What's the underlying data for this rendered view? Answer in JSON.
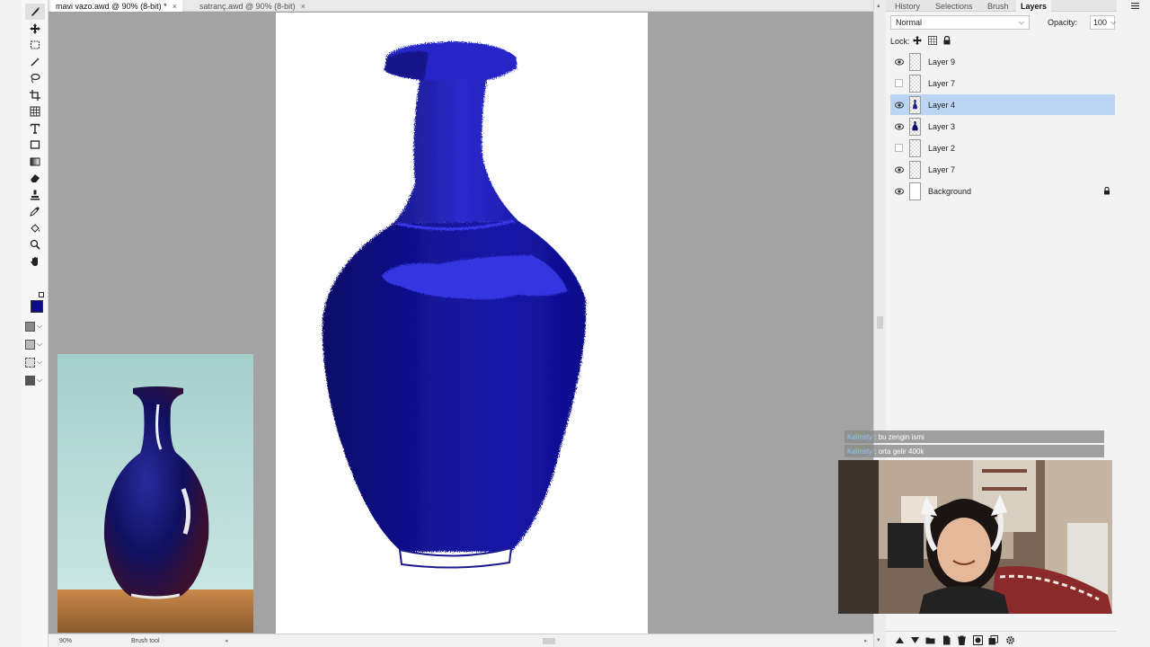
{
  "tabs": [
    {
      "label": "mavi vazo.awd @ 90% (8-bit) *",
      "close": "×",
      "active": true
    },
    {
      "label": "satranç.awd @ 90% (8-bit)",
      "close": "×",
      "active": false
    }
  ],
  "toolbar": {
    "tools": [
      "brush-icon",
      "move-icon",
      "rect-select-icon",
      "magic-wand-icon",
      "lasso-icon",
      "crop-icon",
      "grid-icon",
      "text-icon",
      "shape-icon",
      "gradient-icon",
      "eraser-icon",
      "stamp-icon",
      "eyedropper-icon",
      "fill-icon",
      "zoom-icon",
      "hand-icon"
    ],
    "active_tool": "brush-icon",
    "foreground_color": "#0d0d8c"
  },
  "panel": {
    "tabs": [
      {
        "label": "History",
        "active": false
      },
      {
        "label": "Selections",
        "active": false
      },
      {
        "label": "Brush",
        "active": false
      },
      {
        "label": "Layers",
        "active": true
      }
    ],
    "blend_mode": "Normal",
    "opacity_label": "Opacity:",
    "opacity_value": "100",
    "lock_label": "Lock:",
    "layers": [
      {
        "name": "Layer 9",
        "visible": true,
        "selected": false,
        "locked": false
      },
      {
        "name": "Layer 7",
        "visible": false,
        "selected": false,
        "locked": false
      },
      {
        "name": "Layer 4",
        "visible": true,
        "selected": true,
        "locked": false
      },
      {
        "name": "Layer 3",
        "visible": true,
        "selected": false,
        "locked": false
      },
      {
        "name": "Layer 2",
        "visible": false,
        "selected": false,
        "locked": false
      },
      {
        "name": "Layer 7",
        "visible": true,
        "selected": false,
        "locked": false
      },
      {
        "name": "Background",
        "visible": true,
        "selected": false,
        "locked": true
      }
    ],
    "selection_color": "#bcd5f3"
  },
  "status": {
    "zoom": "90%",
    "tool": "Brush tool"
  },
  "chat": [
    {
      "user": "Kelinsty",
      "sep": " : ",
      "message": "bu zengin ismi"
    },
    {
      "user": "Kelinsty",
      "sep": " : ",
      "message": "orta gelir 400k"
    }
  ],
  "colors": {
    "vase_dark": "#0d0d6e",
    "vase_mid": "#1f1fb3",
    "vase_light": "#3a3ae6",
    "canvas_bg": "#a3a3a3"
  }
}
